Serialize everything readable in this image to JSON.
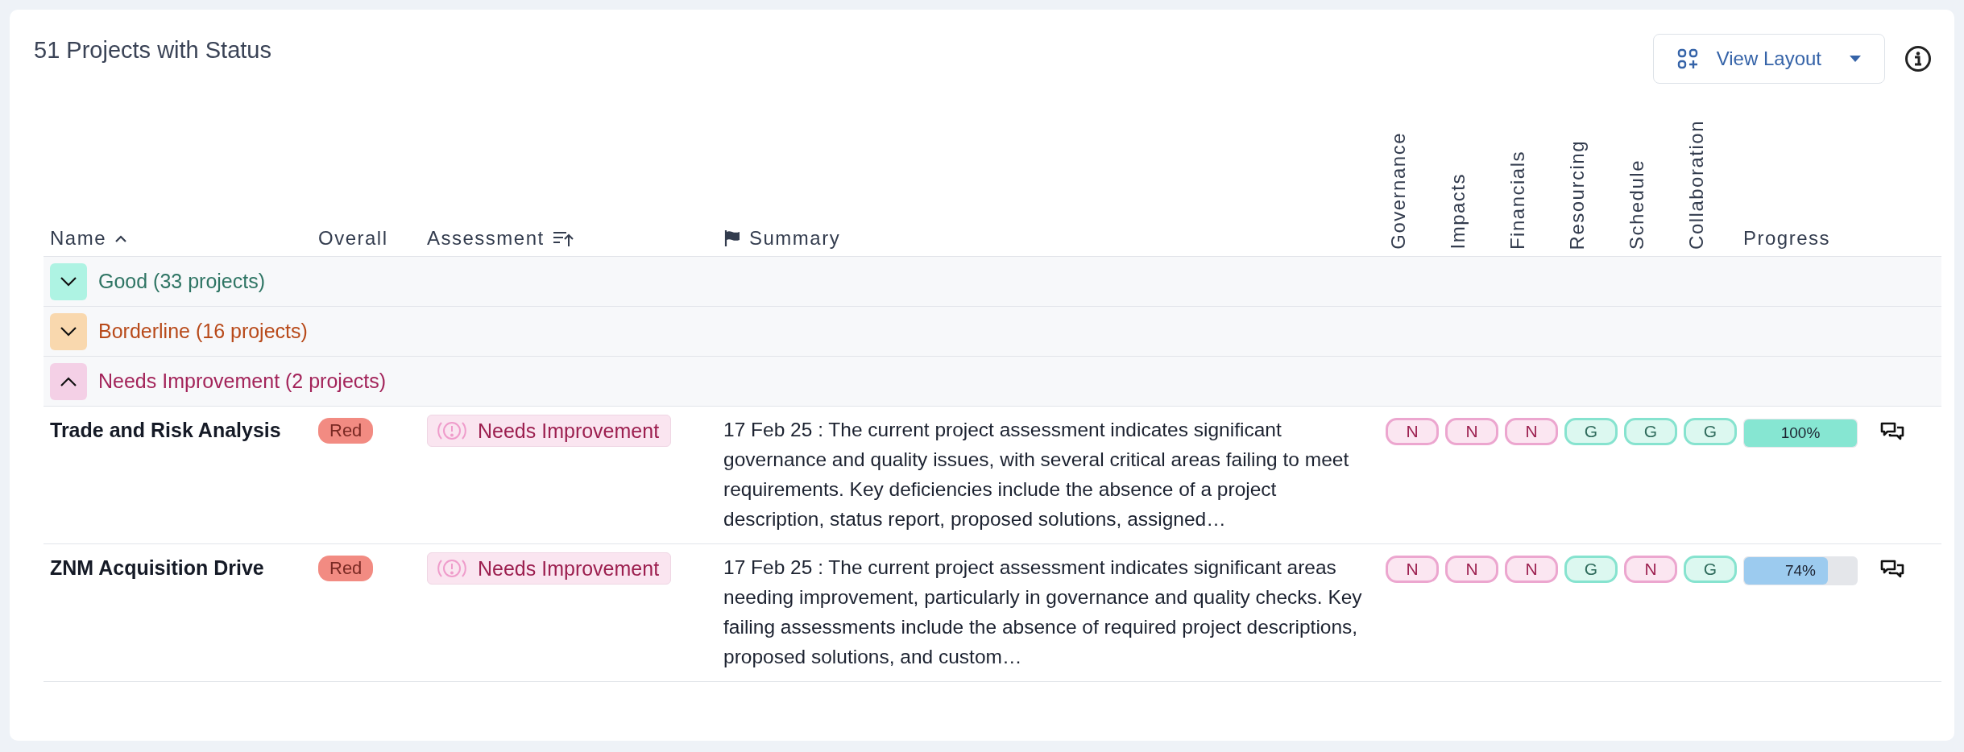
{
  "title": "51 Projects with Status",
  "view_layout_button": {
    "label": "View Layout"
  },
  "table": {
    "columns": [
      {
        "label": "Name"
      },
      {
        "label": "Overall"
      },
      {
        "label": "Assessment"
      },
      {
        "label": "Summary"
      }
    ],
    "rating_columns": [
      {
        "label": "Governance"
      },
      {
        "label": "Impacts"
      },
      {
        "label": "Financials"
      },
      {
        "label": "Resourcing"
      },
      {
        "label": "Schedule"
      },
      {
        "label": "Collaboration"
      }
    ],
    "progress_column": {
      "label": "Progress"
    },
    "groups": [
      {
        "label": "Good (33 projects)",
        "kind": "good",
        "expanded": false
      },
      {
        "label": "Borderline (16 projects)",
        "kind": "borderline",
        "expanded": false
      },
      {
        "label": "Needs Improvement (2 projects)",
        "kind": "needs",
        "expanded": true,
        "rows": [
          {
            "name": "Trade and Risk Analysis",
            "overall": {
              "label": "Red",
              "color": "#f28b82"
            },
            "assessment": {
              "label": "Needs Improvement",
              "kind": "needs"
            },
            "summary": "17 Feb 25 : The current project assessment indicates significant governance and quality issues, with several critical areas failing to meet requirements. Key deficiencies include the absence of a project description, status report, proposed solutions, assigned…",
            "ratings": [
              {
                "label": "N",
                "kind": "needs"
              },
              {
                "label": "N",
                "kind": "needs"
              },
              {
                "label": "N",
                "kind": "needs"
              },
              {
                "label": "G",
                "kind": "good"
              },
              {
                "label": "G",
                "kind": "good"
              },
              {
                "label": "G",
                "kind": "good"
              }
            ],
            "progress": {
              "level": 1.0,
              "reading": "100%"
            }
          },
          {
            "name": "ZNM Acquisition Drive",
            "overall": {
              "label": "Red",
              "color": "#f28b82"
            },
            "assessment": {
              "label": "Needs Improvement",
              "kind": "needs"
            },
            "summary": "17 Feb 25 : The current project assessment indicates significant areas needing improvement, particularly in governance and quality checks. Key failing assessments include the absence of required project descriptions, proposed solutions, and custom…",
            "ratings": [
              {
                "label": "N",
                "kind": "needs"
              },
              {
                "label": "N",
                "kind": "needs"
              },
              {
                "label": "N",
                "kind": "needs"
              },
              {
                "label": "G",
                "kind": "good"
              },
              {
                "label": "N",
                "kind": "needs"
              },
              {
                "label": "G",
                "kind": "good"
              }
            ],
            "progress": {
              "level": 0.74,
              "reading": "74%"
            }
          }
        ]
      }
    ]
  }
}
